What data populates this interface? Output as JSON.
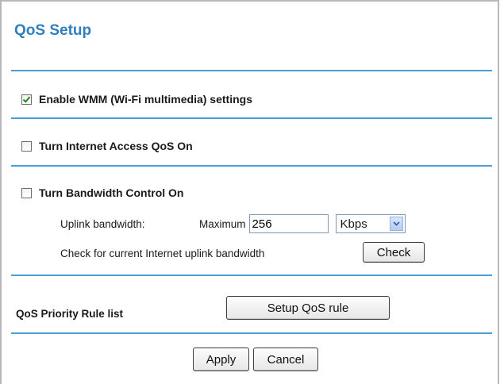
{
  "title": "QoS Setup",
  "wmm": {
    "label": "Enable WMM (Wi-Fi multimedia) settings",
    "checked": true
  },
  "internet_qos": {
    "label": "Turn Internet Access QoS On",
    "checked": false
  },
  "bandwidth": {
    "label": "Turn Bandwidth Control On",
    "checked": false,
    "uplink_label": "Uplink bandwidth:",
    "maximum_label": "Maximum",
    "maximum_value": "256",
    "unit_selected": "Kbps",
    "check_text": "Check for current Internet uplink bandwidth",
    "check_button": "Check"
  },
  "priority": {
    "label": "QoS Priority Rule list",
    "setup_button": "Setup QoS rule"
  },
  "actions": {
    "apply": "Apply",
    "cancel": "Cancel"
  },
  "colors": {
    "title": "#2f7fbf",
    "rule": "#4a9fd8"
  }
}
